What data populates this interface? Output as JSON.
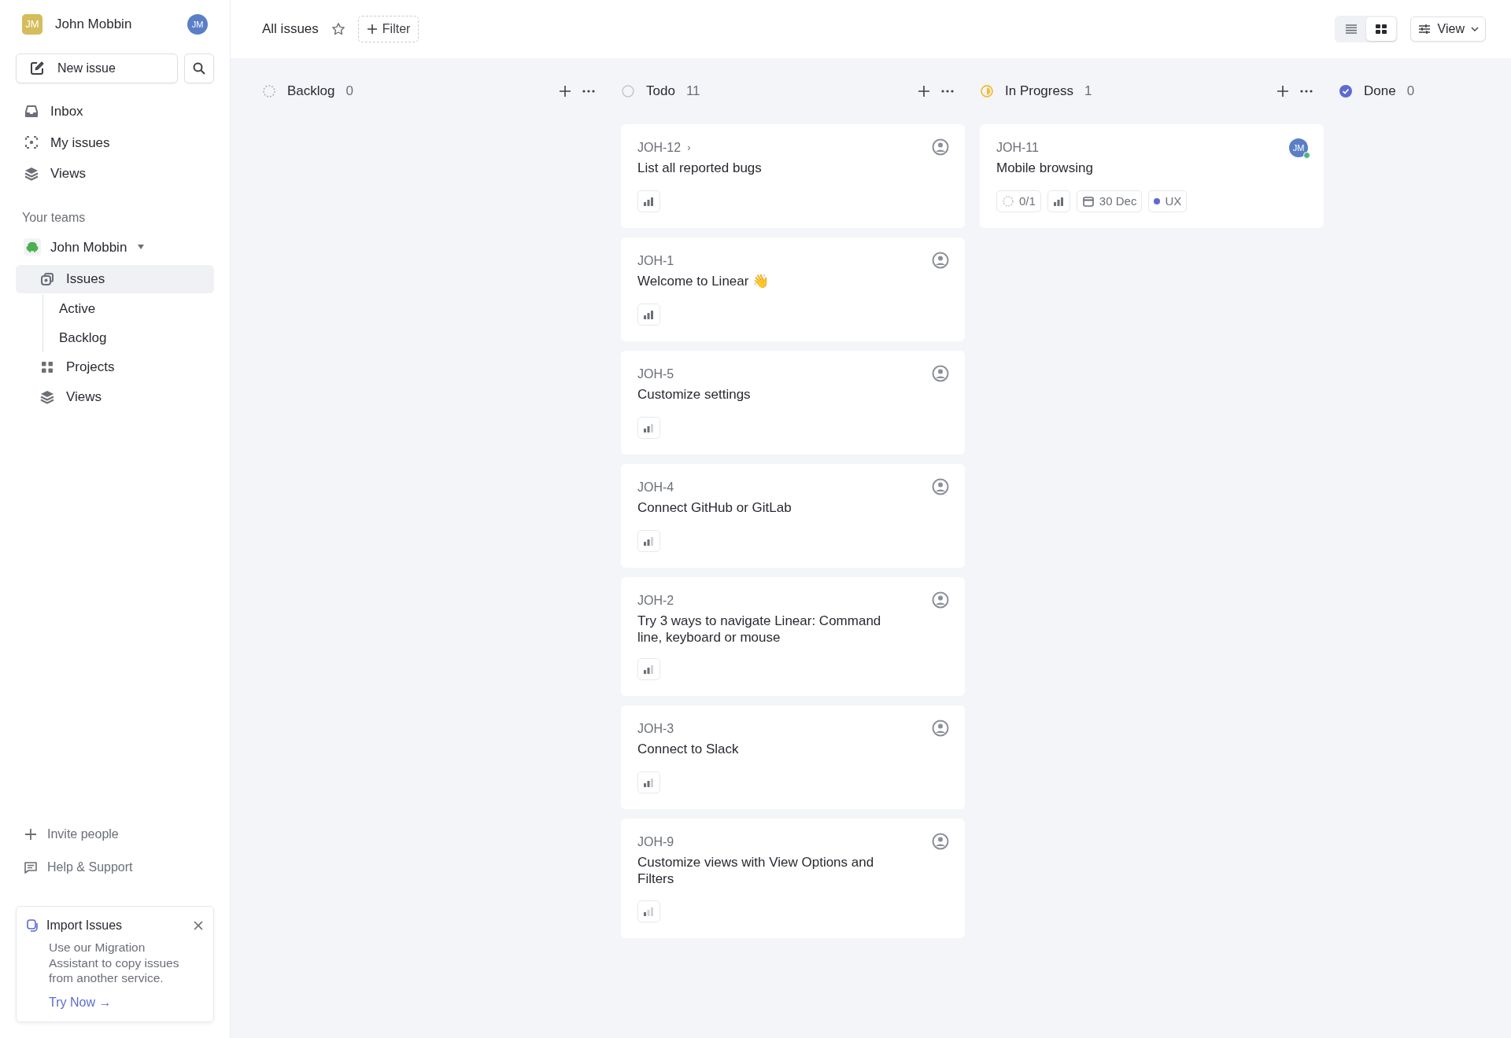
{
  "workspace": {
    "initials": "JM",
    "name": "John Mobbin",
    "user_initials": "JM"
  },
  "new_issue": {
    "label": "New issue"
  },
  "nav": [
    {
      "label": "Inbox",
      "kind": "inbox"
    },
    {
      "label": "My issues",
      "kind": "focus"
    },
    {
      "label": "Views",
      "kind": "layers"
    }
  ],
  "teams_heading": "Your teams",
  "team": {
    "name": "John Mobbin",
    "expanded": true,
    "items": [
      {
        "label": "Issues",
        "kind": "issues",
        "selected": true,
        "children": [
          {
            "label": "Active",
            "selected": false
          },
          {
            "label": "Backlog",
            "selected": false
          }
        ]
      },
      {
        "label": "Projects",
        "kind": "grid",
        "selected": false
      },
      {
        "label": "Views",
        "kind": "layers",
        "selected": false
      }
    ]
  },
  "footer_links": [
    {
      "label": "Invite people",
      "kind": "plus"
    },
    {
      "label": "Help & Support",
      "kind": "chat"
    }
  ],
  "import_card": {
    "title": "Import Issues",
    "text": "Use our Migration Assistant to copy issues from another service.",
    "link": "Try Now →"
  },
  "header": {
    "title": "All issues",
    "filter": "Filter",
    "view": "View",
    "layouts": [
      {
        "kind": "list",
        "selected": false
      },
      {
        "kind": "board",
        "selected": true
      }
    ]
  },
  "columns": [
    {
      "name": "Backlog",
      "count": "0",
      "kind": "backlog"
    },
    {
      "name": "Todo",
      "count": "11",
      "kind": "todo",
      "cards": [
        {
          "id": "JOH-12",
          "subissue_mark": "›",
          "title": "List all reported bugs",
          "kind": "high"
        },
        {
          "id": "JOH-1",
          "title": "Welcome to Linear 👋",
          "kind": "high"
        },
        {
          "id": "JOH-5",
          "title": "Customize settings",
          "kind": "medium"
        },
        {
          "id": "JOH-4",
          "title": "Connect GitHub or GitLab",
          "kind": "medium"
        },
        {
          "id": "JOH-2",
          "title": "Try 3 ways to navigate Linear: Command line, keyboard or mouse",
          "kind": "medium"
        },
        {
          "id": "JOH-3",
          "title": "Connect to Slack",
          "kind": "medium"
        },
        {
          "id": "JOH-9",
          "title": "Customize views with View Options and Filters",
          "kind": "low"
        }
      ]
    },
    {
      "name": "In Progress",
      "count": "1",
      "kind": "in_progress",
      "cards": [
        {
          "id": "JOH-11",
          "title": "Mobile browsing",
          "kind": "high",
          "assignee": "JM",
          "subtasks": "0/1",
          "due": "30 Dec",
          "label": {
            "name": "UX",
            "color": "#5e6ad2"
          }
        }
      ]
    },
    {
      "name": "Done",
      "count": "0",
      "kind": "done"
    }
  ]
}
